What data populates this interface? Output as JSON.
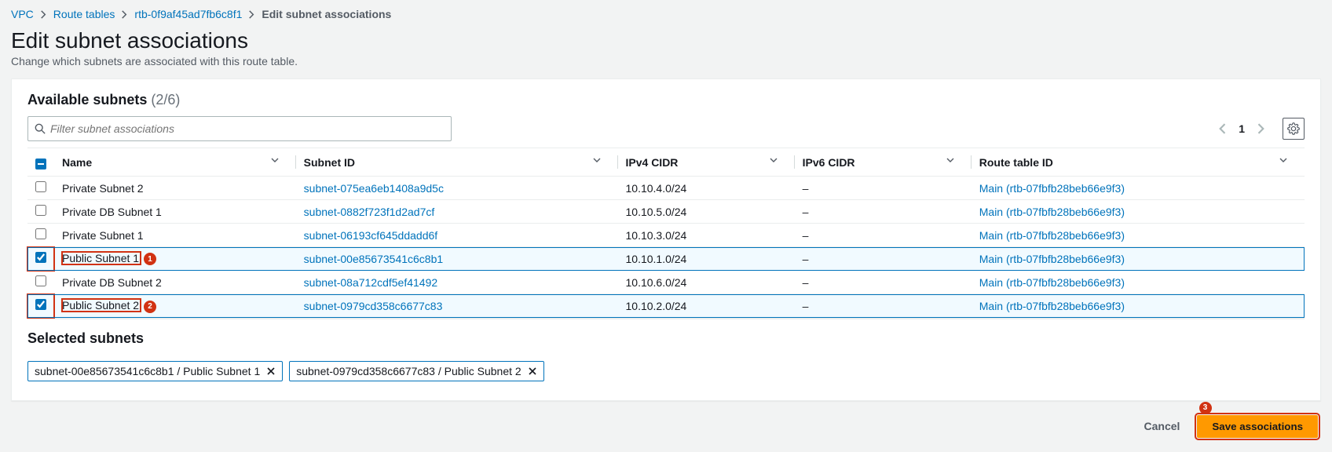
{
  "breadcrumb": {
    "items": [
      {
        "label": "VPC",
        "link": true
      },
      {
        "label": "Route tables",
        "link": true
      },
      {
        "label": "rtb-0f9af45ad7fb6c8f1",
        "link": true
      },
      {
        "label": "Edit subnet associations",
        "link": false
      }
    ]
  },
  "header": {
    "title": "Edit subnet associations",
    "subtitle": "Change which subnets are associated with this route table."
  },
  "available": {
    "title": "Available subnets",
    "count_label": "(2/6)",
    "filter_placeholder": "Filter subnet associations",
    "page": "1"
  },
  "columns": {
    "name": "Name",
    "subnet_id": "Subnet ID",
    "ipv4": "IPv4 CIDR",
    "ipv6": "IPv6 CIDR",
    "rtid": "Route table ID"
  },
  "rows": [
    {
      "checked": false,
      "name": "Private Subnet 2",
      "subnet_id": "subnet-075ea6eb1408a9d5c",
      "ipv4": "10.10.4.0/24",
      "ipv6": "–",
      "route_table": "Main (rtb-07fbfb28beb66e9f3)",
      "annotation": ""
    },
    {
      "checked": false,
      "name": "Private DB Subnet 1",
      "subnet_id": "subnet-0882f723f1d2ad7cf",
      "ipv4": "10.10.5.0/24",
      "ipv6": "–",
      "route_table": "Main (rtb-07fbfb28beb66e9f3)",
      "annotation": ""
    },
    {
      "checked": false,
      "name": "Private Subnet 1",
      "subnet_id": "subnet-06193cf645ddadd6f",
      "ipv4": "10.10.3.0/24",
      "ipv6": "–",
      "route_table": "Main (rtb-07fbfb28beb66e9f3)",
      "annotation": ""
    },
    {
      "checked": true,
      "name": "Public Subnet 1",
      "subnet_id": "subnet-00e85673541c6c8b1",
      "ipv4": "10.10.1.0/24",
      "ipv6": "–",
      "route_table": "Main (rtb-07fbfb28beb66e9f3)",
      "annotation": "1"
    },
    {
      "checked": false,
      "name": "Private DB Subnet 2",
      "subnet_id": "subnet-08a712cdf5ef41492",
      "ipv4": "10.10.6.0/24",
      "ipv6": "–",
      "route_table": "Main (rtb-07fbfb28beb66e9f3)",
      "annotation": ""
    },
    {
      "checked": true,
      "name": "Public Subnet 2",
      "subnet_id": "subnet-0979cd358c6677c83",
      "ipv4": "10.10.2.0/24",
      "ipv6": "–",
      "route_table": "Main (rtb-07fbfb28beb66e9f3)",
      "annotation": "2"
    }
  ],
  "selected": {
    "title": "Selected subnets",
    "tokens": [
      "subnet-00e85673541c6c8b1 / Public Subnet 1",
      "subnet-0979cd358c6677c83 / Public Subnet 2"
    ]
  },
  "footer": {
    "annotation": "3",
    "cancel": "Cancel",
    "save": "Save associations"
  }
}
